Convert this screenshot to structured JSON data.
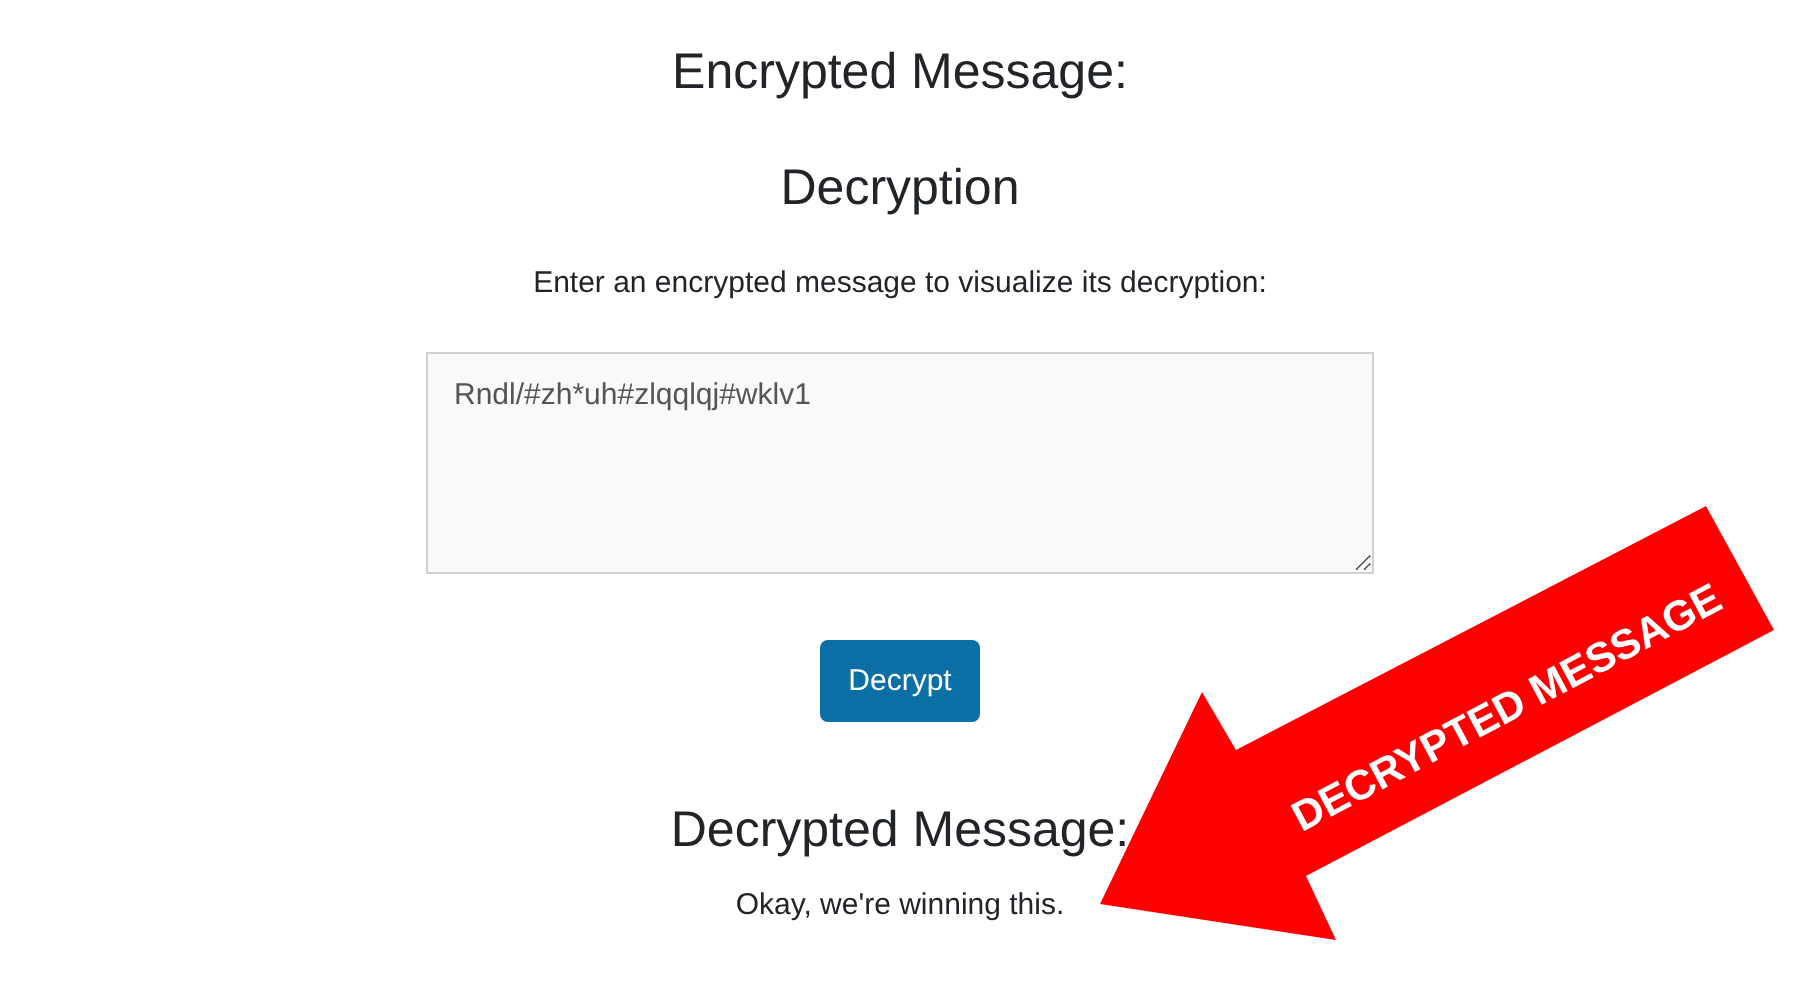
{
  "encrypted_heading": "Encrypted Message:",
  "section_title": "Decryption",
  "instruction": "Enter an encrypted message to visualize its decryption:",
  "message_field": {
    "value": "Rndl/#zh*uh#zlqqlqj#wklv1"
  },
  "decrypt_button": "Decrypt",
  "decrypted_heading": "Decrypted Message:",
  "decrypted_text": "Okay, we're winning this.",
  "annotation": {
    "label": "DECRYPTED MESSAGE",
    "color": "#ff0000"
  }
}
